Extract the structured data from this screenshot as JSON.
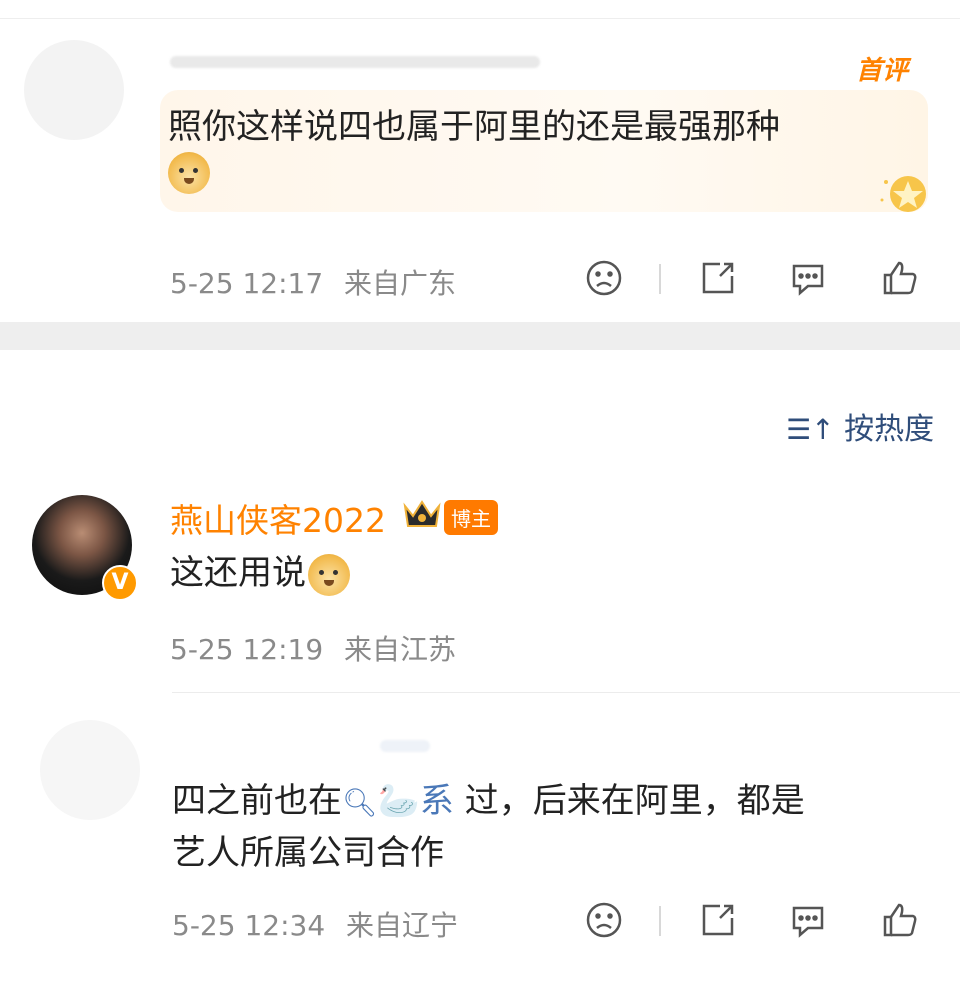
{
  "comment1": {
    "badge": "首评",
    "text": "照你这样说四也属于阿里的还是最强那种",
    "time": "5-25 12:17",
    "location": "来自广东",
    "icons": [
      "sad-face-icon",
      "share-icon",
      "comment-icon",
      "like-icon"
    ]
  },
  "sort": {
    "label": "按热度",
    "icon": "sort-icon"
  },
  "comment2": {
    "username": "燕山侠客2022",
    "role_badge": "博主",
    "avatar_badge": "V",
    "text": "这还用说",
    "time": "5-25 12:19",
    "location": "来自江苏"
  },
  "comment3": {
    "text_line1_before": "四之前也在",
    "link_text": "系",
    "text_line1_after": " 过，后来在阿里，都是",
    "text_line2": "艺人所属公司合作",
    "time": "5-25 12:34",
    "location": "来自辽宁"
  },
  "colors": {
    "accent_orange": "#ff8200",
    "link_blue": "#4a78b8",
    "meta_gray": "#8a8a8a"
  }
}
